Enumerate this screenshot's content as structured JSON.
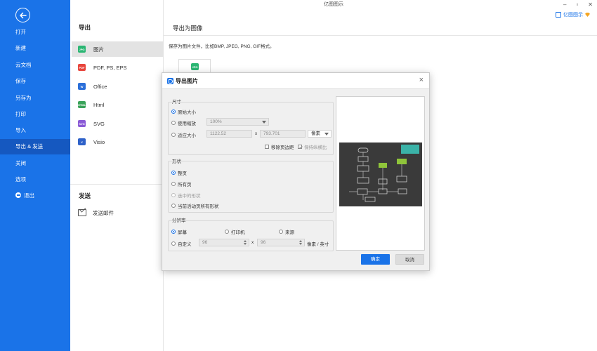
{
  "app": {
    "title": "亿图图示",
    "brand_label": "亿图图示"
  },
  "window_controls": {
    "minimize": "–",
    "maximize": "▫",
    "close": "✕"
  },
  "sidebar": {
    "items": [
      {
        "label": "打开"
      },
      {
        "label": "新建"
      },
      {
        "label": "云文档"
      },
      {
        "label": "保存"
      },
      {
        "label": "另存为"
      },
      {
        "label": "打印"
      },
      {
        "label": "导入"
      },
      {
        "label": "导出 & 发送"
      },
      {
        "label": "关闭"
      },
      {
        "label": "选项"
      },
      {
        "label": "退出"
      }
    ]
  },
  "export_panel": {
    "export_title": "导出",
    "formats": [
      {
        "label": "图片",
        "icon": "JPG",
        "color": "#2bb673"
      },
      {
        "label": "PDF, PS, EPS",
        "icon": "PDF",
        "color": "#e8453c"
      },
      {
        "label": "Office",
        "icon": "W",
        "color": "#2b6fd9"
      },
      {
        "label": "Html",
        "icon": "HTML",
        "color": "#3aa35a"
      },
      {
        "label": "SVG",
        "icon": "SVG",
        "color": "#8a5bd6"
      },
      {
        "label": "Visio",
        "icon": "V",
        "color": "#2f62c9"
      }
    ],
    "send_title": "发送",
    "send_email": "发送邮件"
  },
  "content": {
    "heading": "导出为图像",
    "description": "保存为图片文件，比如BMP, JPEG, PNG, GIF格式。",
    "thumb_icon": "JPG"
  },
  "dialog": {
    "title": "导出图片",
    "close": "×",
    "size": {
      "label": "尺寸",
      "original": "原始大小",
      "use_scale": "使用缩放",
      "scale_value": "100%",
      "fit_size": "适应大小",
      "width": "1122.52",
      "x": "x",
      "height": "793.701",
      "unit": "像素",
      "remove_margin": "移除页边距",
      "keep_ratio": "保持纵横比"
    },
    "shape": {
      "label": "形状",
      "whole_page": "整页",
      "all_pages": "所有页",
      "selected": "选中的形状",
      "current_page_all": "当前活动页所有形状"
    },
    "resolution": {
      "label": "分辨率",
      "screen": "屏幕",
      "printer": "打印机",
      "source": "来源",
      "custom": "自定义",
      "dpi_x": "96",
      "x": "x",
      "dpi_y": "96",
      "unit": "像素 / 英寸"
    },
    "ok": "确定",
    "cancel": "取消"
  }
}
